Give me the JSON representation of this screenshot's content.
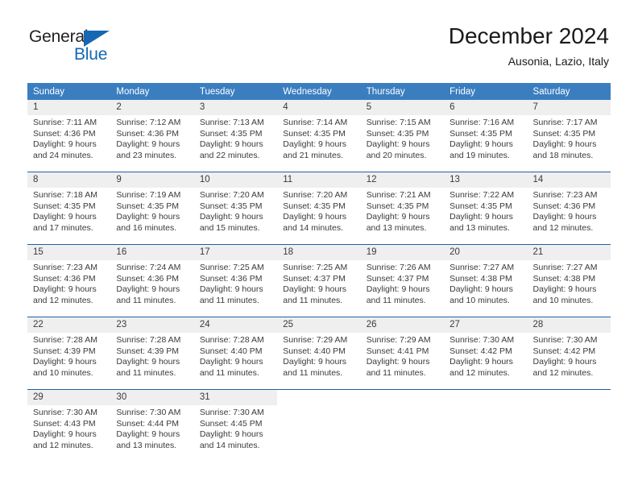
{
  "logo": {
    "word_top": "General",
    "word_bottom": "Blue",
    "triangle_color": "#1567b2"
  },
  "header": {
    "title": "December 2024",
    "subtitle": "Ausonia, Lazio, Italy"
  },
  "colors": {
    "header_row_bg": "#3a7ec0",
    "week_divider": "#1f5fa9",
    "daynum_band_bg": "#efefef",
    "text": "#3a3a3a"
  },
  "calendar": {
    "weekday_headers": [
      "Sunday",
      "Monday",
      "Tuesday",
      "Wednesday",
      "Thursday",
      "Friday",
      "Saturday"
    ],
    "weeks": [
      {
        "days": [
          {
            "day": "1",
            "sunrise": "Sunrise: 7:11 AM",
            "sunset": "Sunset: 4:36 PM",
            "daylight_line1": "Daylight: 9 hours",
            "daylight_line2": "and 24 minutes."
          },
          {
            "day": "2",
            "sunrise": "Sunrise: 7:12 AM",
            "sunset": "Sunset: 4:36 PM",
            "daylight_line1": "Daylight: 9 hours",
            "daylight_line2": "and 23 minutes."
          },
          {
            "day": "3",
            "sunrise": "Sunrise: 7:13 AM",
            "sunset": "Sunset: 4:35 PM",
            "daylight_line1": "Daylight: 9 hours",
            "daylight_line2": "and 22 minutes."
          },
          {
            "day": "4",
            "sunrise": "Sunrise: 7:14 AM",
            "sunset": "Sunset: 4:35 PM",
            "daylight_line1": "Daylight: 9 hours",
            "daylight_line2": "and 21 minutes."
          },
          {
            "day": "5",
            "sunrise": "Sunrise: 7:15 AM",
            "sunset": "Sunset: 4:35 PM",
            "daylight_line1": "Daylight: 9 hours",
            "daylight_line2": "and 20 minutes."
          },
          {
            "day": "6",
            "sunrise": "Sunrise: 7:16 AM",
            "sunset": "Sunset: 4:35 PM",
            "daylight_line1": "Daylight: 9 hours",
            "daylight_line2": "and 19 minutes."
          },
          {
            "day": "7",
            "sunrise": "Sunrise: 7:17 AM",
            "sunset": "Sunset: 4:35 PM",
            "daylight_line1": "Daylight: 9 hours",
            "daylight_line2": "and 18 minutes."
          }
        ]
      },
      {
        "days": [
          {
            "day": "8",
            "sunrise": "Sunrise: 7:18 AM",
            "sunset": "Sunset: 4:35 PM",
            "daylight_line1": "Daylight: 9 hours",
            "daylight_line2": "and 17 minutes."
          },
          {
            "day": "9",
            "sunrise": "Sunrise: 7:19 AM",
            "sunset": "Sunset: 4:35 PM",
            "daylight_line1": "Daylight: 9 hours",
            "daylight_line2": "and 16 minutes."
          },
          {
            "day": "10",
            "sunrise": "Sunrise: 7:20 AM",
            "sunset": "Sunset: 4:35 PM",
            "daylight_line1": "Daylight: 9 hours",
            "daylight_line2": "and 15 minutes."
          },
          {
            "day": "11",
            "sunrise": "Sunrise: 7:20 AM",
            "sunset": "Sunset: 4:35 PM",
            "daylight_line1": "Daylight: 9 hours",
            "daylight_line2": "and 14 minutes."
          },
          {
            "day": "12",
            "sunrise": "Sunrise: 7:21 AM",
            "sunset": "Sunset: 4:35 PM",
            "daylight_line1": "Daylight: 9 hours",
            "daylight_line2": "and 13 minutes."
          },
          {
            "day": "13",
            "sunrise": "Sunrise: 7:22 AM",
            "sunset": "Sunset: 4:35 PM",
            "daylight_line1": "Daylight: 9 hours",
            "daylight_line2": "and 13 minutes."
          },
          {
            "day": "14",
            "sunrise": "Sunrise: 7:23 AM",
            "sunset": "Sunset: 4:36 PM",
            "daylight_line1": "Daylight: 9 hours",
            "daylight_line2": "and 12 minutes."
          }
        ]
      },
      {
        "days": [
          {
            "day": "15",
            "sunrise": "Sunrise: 7:23 AM",
            "sunset": "Sunset: 4:36 PM",
            "daylight_line1": "Daylight: 9 hours",
            "daylight_line2": "and 12 minutes."
          },
          {
            "day": "16",
            "sunrise": "Sunrise: 7:24 AM",
            "sunset": "Sunset: 4:36 PM",
            "daylight_line1": "Daylight: 9 hours",
            "daylight_line2": "and 11 minutes."
          },
          {
            "day": "17",
            "sunrise": "Sunrise: 7:25 AM",
            "sunset": "Sunset: 4:36 PM",
            "daylight_line1": "Daylight: 9 hours",
            "daylight_line2": "and 11 minutes."
          },
          {
            "day": "18",
            "sunrise": "Sunrise: 7:25 AM",
            "sunset": "Sunset: 4:37 PM",
            "daylight_line1": "Daylight: 9 hours",
            "daylight_line2": "and 11 minutes."
          },
          {
            "day": "19",
            "sunrise": "Sunrise: 7:26 AM",
            "sunset": "Sunset: 4:37 PM",
            "daylight_line1": "Daylight: 9 hours",
            "daylight_line2": "and 11 minutes."
          },
          {
            "day": "20",
            "sunrise": "Sunrise: 7:27 AM",
            "sunset": "Sunset: 4:38 PM",
            "daylight_line1": "Daylight: 9 hours",
            "daylight_line2": "and 10 minutes."
          },
          {
            "day": "21",
            "sunrise": "Sunrise: 7:27 AM",
            "sunset": "Sunset: 4:38 PM",
            "daylight_line1": "Daylight: 9 hours",
            "daylight_line2": "and 10 minutes."
          }
        ]
      },
      {
        "days": [
          {
            "day": "22",
            "sunrise": "Sunrise: 7:28 AM",
            "sunset": "Sunset: 4:39 PM",
            "daylight_line1": "Daylight: 9 hours",
            "daylight_line2": "and 10 minutes."
          },
          {
            "day": "23",
            "sunrise": "Sunrise: 7:28 AM",
            "sunset": "Sunset: 4:39 PM",
            "daylight_line1": "Daylight: 9 hours",
            "daylight_line2": "and 11 minutes."
          },
          {
            "day": "24",
            "sunrise": "Sunrise: 7:28 AM",
            "sunset": "Sunset: 4:40 PM",
            "daylight_line1": "Daylight: 9 hours",
            "daylight_line2": "and 11 minutes."
          },
          {
            "day": "25",
            "sunrise": "Sunrise: 7:29 AM",
            "sunset": "Sunset: 4:40 PM",
            "daylight_line1": "Daylight: 9 hours",
            "daylight_line2": "and 11 minutes."
          },
          {
            "day": "26",
            "sunrise": "Sunrise: 7:29 AM",
            "sunset": "Sunset: 4:41 PM",
            "daylight_line1": "Daylight: 9 hours",
            "daylight_line2": "and 11 minutes."
          },
          {
            "day": "27",
            "sunrise": "Sunrise: 7:30 AM",
            "sunset": "Sunset: 4:42 PM",
            "daylight_line1": "Daylight: 9 hours",
            "daylight_line2": "and 12 minutes."
          },
          {
            "day": "28",
            "sunrise": "Sunrise: 7:30 AM",
            "sunset": "Sunset: 4:42 PM",
            "daylight_line1": "Daylight: 9 hours",
            "daylight_line2": "and 12 minutes."
          }
        ]
      },
      {
        "days": [
          {
            "day": "29",
            "sunrise": "Sunrise: 7:30 AM",
            "sunset": "Sunset: 4:43 PM",
            "daylight_line1": "Daylight: 9 hours",
            "daylight_line2": "and 12 minutes."
          },
          {
            "day": "30",
            "sunrise": "Sunrise: 7:30 AM",
            "sunset": "Sunset: 4:44 PM",
            "daylight_line1": "Daylight: 9 hours",
            "daylight_line2": "and 13 minutes."
          },
          {
            "day": "31",
            "sunrise": "Sunrise: 7:30 AM",
            "sunset": "Sunset: 4:45 PM",
            "daylight_line1": "Daylight: 9 hours",
            "daylight_line2": "and 14 minutes."
          },
          {
            "day": "",
            "sunrise": "",
            "sunset": "",
            "daylight_line1": "",
            "daylight_line2": ""
          },
          {
            "day": "",
            "sunrise": "",
            "sunset": "",
            "daylight_line1": "",
            "daylight_line2": ""
          },
          {
            "day": "",
            "sunrise": "",
            "sunset": "",
            "daylight_line1": "",
            "daylight_line2": ""
          },
          {
            "day": "",
            "sunrise": "",
            "sunset": "",
            "daylight_line1": "",
            "daylight_line2": ""
          }
        ]
      }
    ]
  }
}
